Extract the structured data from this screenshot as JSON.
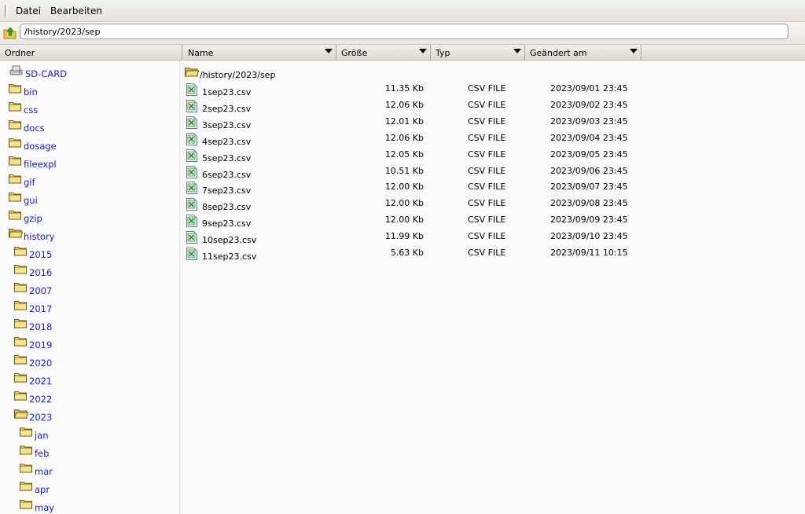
{
  "menu": {
    "items": [
      "Datei",
      "Bearbeiten"
    ]
  },
  "address": {
    "path": "/history/2023/sep"
  },
  "columns": {
    "folders": "Ordner",
    "name": "Name",
    "size": "Größe",
    "type": "Typ",
    "modified": "Geändert am"
  },
  "tree": {
    "root": "SD-CARD",
    "items": [
      {
        "label": "bin",
        "icon": "folder-closed-icon",
        "level": 1
      },
      {
        "label": "css",
        "icon": "folder-closed-icon",
        "level": 1
      },
      {
        "label": "docs",
        "icon": "folder-closed-icon",
        "level": 1
      },
      {
        "label": "dosage",
        "icon": "folder-closed-icon",
        "level": 1
      },
      {
        "label": "fileexpl",
        "icon": "folder-closed-icon",
        "level": 1
      },
      {
        "label": "gif",
        "icon": "folder-closed-icon",
        "level": 1
      },
      {
        "label": "gui",
        "icon": "folder-closed-icon",
        "level": 1
      },
      {
        "label": "gzip",
        "icon": "folder-closed-icon",
        "level": 1
      },
      {
        "label": "history",
        "icon": "folder-open-icon",
        "level": 1
      },
      {
        "label": "2015",
        "icon": "folder-closed-icon",
        "level": 2
      },
      {
        "label": "2016",
        "icon": "folder-closed-icon",
        "level": 2
      },
      {
        "label": "2007",
        "icon": "folder-closed-icon",
        "level": 2
      },
      {
        "label": "2017",
        "icon": "folder-closed-icon",
        "level": 2
      },
      {
        "label": "2018",
        "icon": "folder-closed-icon",
        "level": 2
      },
      {
        "label": "2019",
        "icon": "folder-closed-icon",
        "level": 2
      },
      {
        "label": "2020",
        "icon": "folder-closed-icon",
        "level": 2
      },
      {
        "label": "2021",
        "icon": "folder-closed-icon",
        "level": 2
      },
      {
        "label": "2022",
        "icon": "folder-closed-icon",
        "level": 2
      },
      {
        "label": "2023",
        "icon": "folder-open-icon",
        "level": 2
      },
      {
        "label": "jan",
        "icon": "folder-closed-icon",
        "level": 3
      },
      {
        "label": "feb",
        "icon": "folder-closed-icon",
        "level": 3
      },
      {
        "label": "mar",
        "icon": "folder-closed-icon",
        "level": 3
      },
      {
        "label": "apr",
        "icon": "folder-closed-icon",
        "level": 3
      },
      {
        "label": "may",
        "icon": "folder-closed-icon",
        "level": 3
      }
    ]
  },
  "files": {
    "current_folder": "/history/2023/sep",
    "rows": [
      {
        "name": "1sep23.csv",
        "size": "11.35 Kb",
        "type": "CSV FILE",
        "modified": "2023/09/01 23:45"
      },
      {
        "name": "2sep23.csv",
        "size": "12.06 Kb",
        "type": "CSV FILE",
        "modified": "2023/09/02 23:45"
      },
      {
        "name": "3sep23.csv",
        "size": "12.01 Kb",
        "type": "CSV FILE",
        "modified": "2023/09/03 23:45"
      },
      {
        "name": "4sep23.csv",
        "size": "12.06 Kb",
        "type": "CSV FILE",
        "modified": "2023/09/04 23:45"
      },
      {
        "name": "5sep23.csv",
        "size": "12.05 Kb",
        "type": "CSV FILE",
        "modified": "2023/09/05 23:45"
      },
      {
        "name": "6sep23.csv",
        "size": "10.51 Kb",
        "type": "CSV FILE",
        "modified": "2023/09/06 23:45"
      },
      {
        "name": "7sep23.csv",
        "size": "12.00 Kb",
        "type": "CSV FILE",
        "modified": "2023/09/07 23:45"
      },
      {
        "name": "8sep23.csv",
        "size": "12.00 Kb",
        "type": "CSV FILE",
        "modified": "2023/09/08 23:45"
      },
      {
        "name": "9sep23.csv",
        "size": "12.00 Kb",
        "type": "CSV FILE",
        "modified": "2023/09/09 23:45"
      },
      {
        "name": "10sep23.csv",
        "size": "11.99 Kb",
        "type": "CSV FILE",
        "modified": "2023/09/10 23:45"
      },
      {
        "name": "11sep23.csv",
        "size": "5.63 Kb",
        "type": "CSV FILE",
        "modified": "2023/09/11 10:15"
      }
    ]
  },
  "colors": {
    "link": "#1a20c8",
    "folder": "#f2d96b",
    "csv_icon": "#3f9a3f"
  }
}
